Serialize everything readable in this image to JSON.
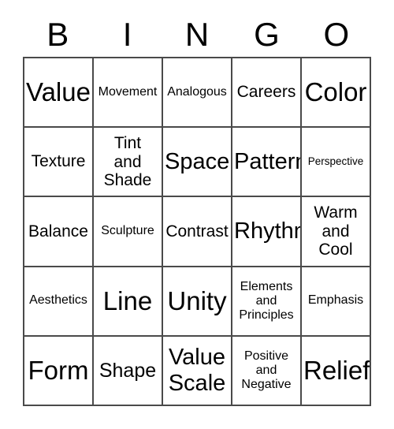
{
  "card": {
    "title": "BINGO",
    "header_letters": [
      "B",
      "I",
      "N",
      "G",
      "O"
    ],
    "columns": 5,
    "rows": 5,
    "colors": {
      "background": "#ffffff",
      "text": "#000000",
      "border": "#4a4a4a"
    },
    "cells": [
      {
        "text": "Value",
        "size": "xxl",
        "lines": 1
      },
      {
        "text": "Movement",
        "size": "sm",
        "lines": 1
      },
      {
        "text": "Analogous",
        "size": "sm",
        "lines": 1
      },
      {
        "text": "Careers",
        "size": "md",
        "lines": 1
      },
      {
        "text": "Color",
        "size": "xxl",
        "lines": 1
      },
      {
        "text": "Texture",
        "size": "md",
        "lines": 1
      },
      {
        "text": "Tint\nand\nShade",
        "size": "md",
        "lines": 3
      },
      {
        "text": "Space",
        "size": "xl",
        "lines": 1
      },
      {
        "text": "Pattern",
        "size": "xl",
        "lines": 1
      },
      {
        "text": "Perspective",
        "size": "xs",
        "lines": 1
      },
      {
        "text": "Balance",
        "size": "md",
        "lines": 1
      },
      {
        "text": "Sculpture",
        "size": "sm",
        "lines": 1
      },
      {
        "text": "Contrast",
        "size": "md",
        "lines": 1
      },
      {
        "text": "Rhythm",
        "size": "xl",
        "lines": 1
      },
      {
        "text": "Warm\nand\nCool",
        "size": "md",
        "lines": 3
      },
      {
        "text": "Aesthetics",
        "size": "sm",
        "lines": 1
      },
      {
        "text": "Line",
        "size": "xxl",
        "lines": 1
      },
      {
        "text": "Unity",
        "size": "xxl",
        "lines": 1
      },
      {
        "text": "Elements\nand\nPrinciples",
        "size": "sm",
        "lines": 3
      },
      {
        "text": "Emphasis",
        "size": "sm",
        "lines": 1
      },
      {
        "text": "Form",
        "size": "xxl",
        "lines": 1
      },
      {
        "text": "Shape",
        "size": "lg",
        "lines": 1
      },
      {
        "text": "Value\nScale",
        "size": "xl",
        "lines": 2
      },
      {
        "text": "Positive\nand\nNegative",
        "size": "sm",
        "lines": 3
      },
      {
        "text": "Relief",
        "size": "xxl",
        "lines": 1
      }
    ]
  }
}
